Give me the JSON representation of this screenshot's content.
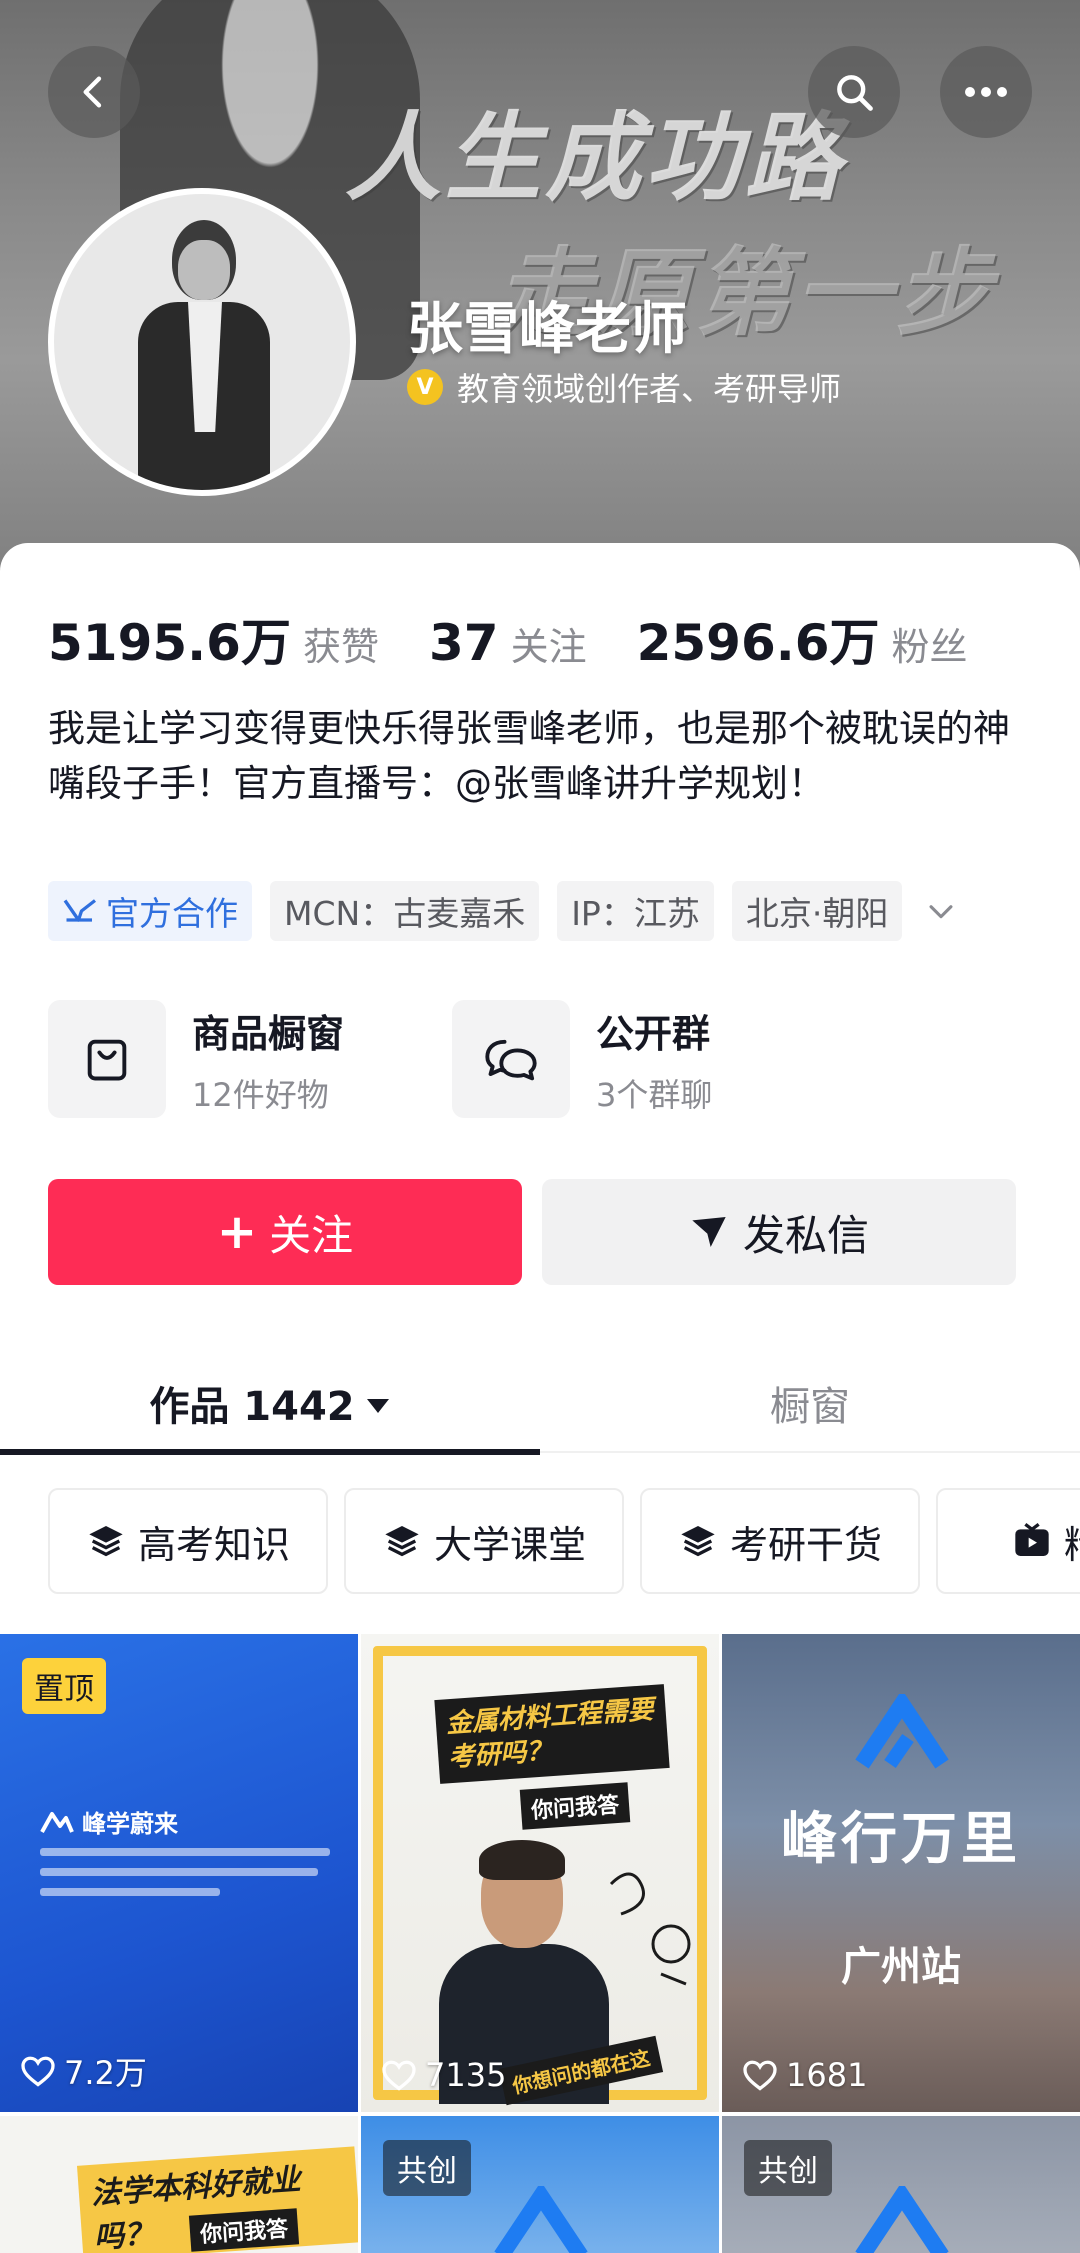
{
  "header": {
    "banner_line1": "人生成功路",
    "banner_line2": "走原第一步",
    "name": "张雪峰老师",
    "verify_icon": "verified-badge-icon",
    "verify_badge_glyph": "V",
    "verification": "教育领域创作者、考研导师",
    "colors": {
      "verify": "#f4c320"
    }
  },
  "stats": [
    {
      "value": "5195.6万",
      "label": "获赞"
    },
    {
      "value": "37",
      "label": "关注"
    },
    {
      "value": "2596.6万",
      "label": "粉丝"
    }
  ],
  "bio": "我是让学习变得更快乐得张雪峰老师，也是那个被耽误的神嘴段子手！官方直播号：@张雪峰讲升学规划！",
  "tags": [
    {
      "label": "官方合作",
      "icon": "official-partner-icon"
    },
    {
      "label": "MCN：古麦嘉禾"
    },
    {
      "label": "IP：江苏"
    },
    {
      "label": "北京·朝阳"
    }
  ],
  "entries": [
    {
      "title": "商品橱窗",
      "sub": "12件好物",
      "icon": "shopping-bag-icon"
    },
    {
      "title": "公开群",
      "sub": "3个群聊",
      "icon": "chat-bubbles-icon"
    }
  ],
  "actions": {
    "follow_plus": "+",
    "follow": "关注",
    "message": "发私信",
    "colors": {
      "follow": "#fe2c55"
    }
  },
  "tabs": {
    "works": "作品 1442",
    "showcase": "橱窗"
  },
  "collections": [
    "高考知识",
    "大学课堂",
    "考研干货",
    "精彩"
  ],
  "videos": [
    {
      "badge": "置顶",
      "likes": "7.2万",
      "brand": "峰学蔚来"
    },
    {
      "likes": "7135",
      "title": "金属材料工程需要考研吗？",
      "sub": "你问我答",
      "sticker": "你想问的都在这"
    },
    {
      "likes": "1681",
      "title": "峰行万里",
      "sub": "广州站"
    },
    {
      "title": "法学本科好就业吗？",
      "sub": "你问我答"
    },
    {
      "badge": "共创"
    },
    {
      "badge": "共创"
    }
  ]
}
